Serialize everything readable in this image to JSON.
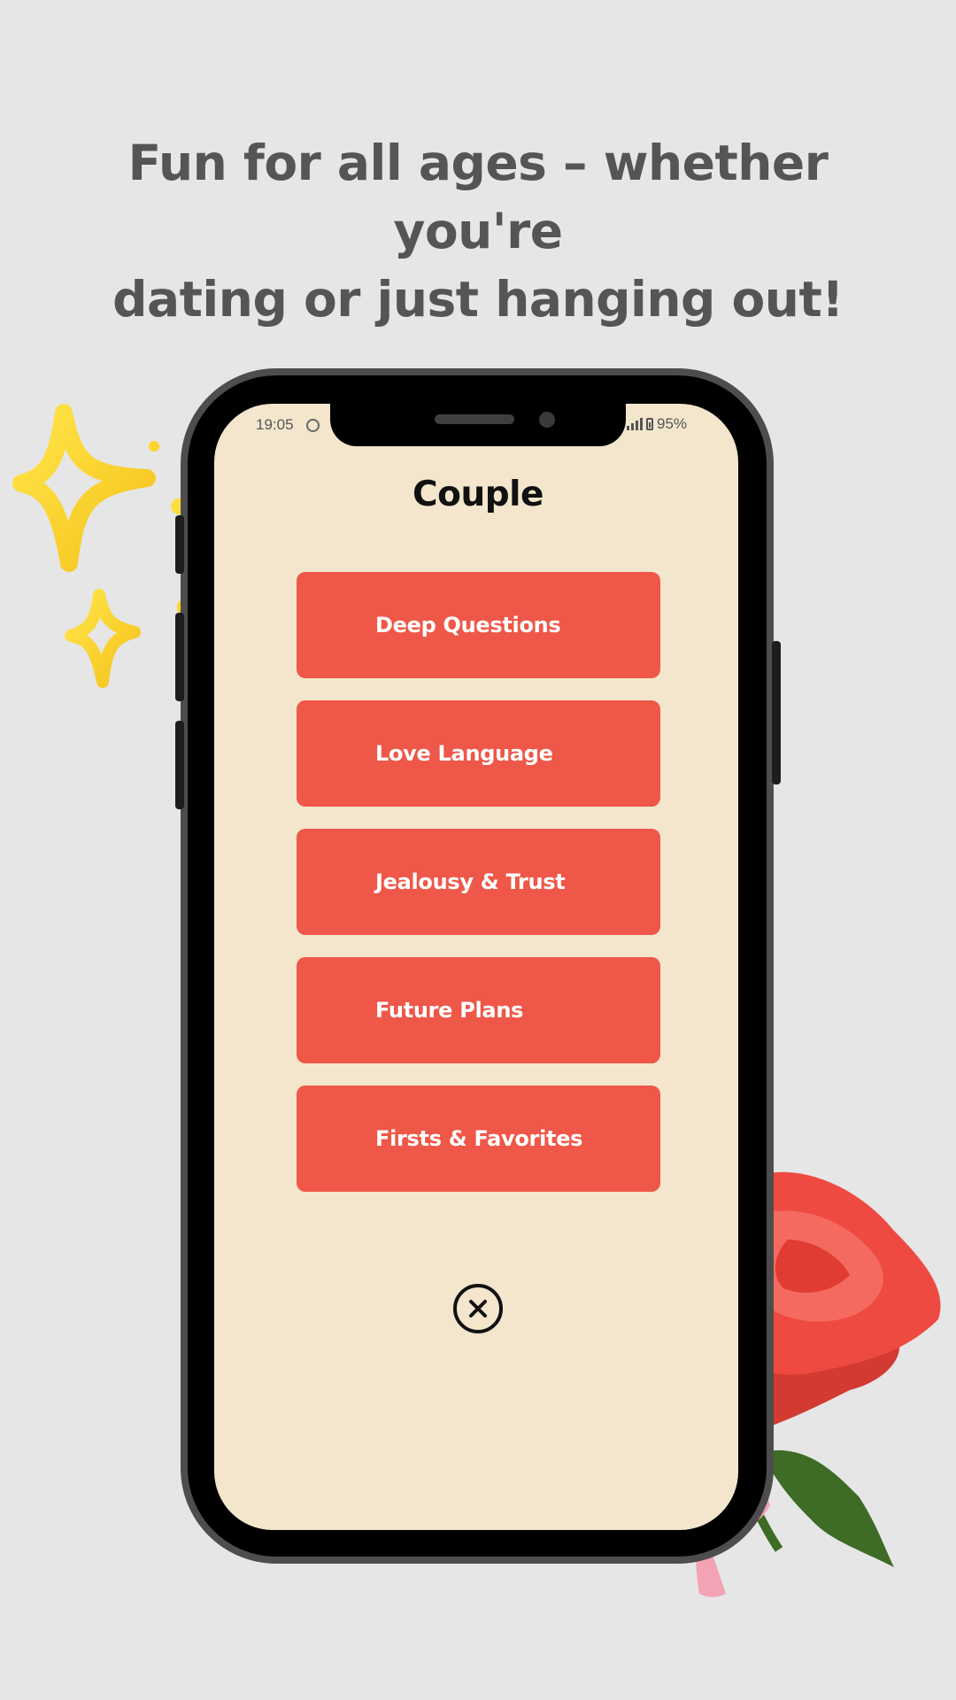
{
  "headline": {
    "line1": "Fun for all ages – whether you're",
    "line2": "dating or just hanging out!"
  },
  "status_bar": {
    "time": "19:05",
    "battery": "95%"
  },
  "screen": {
    "title": "Couple",
    "categories": [
      {
        "label": "Deep Questions"
      },
      {
        "label": "Love Language"
      },
      {
        "label": "Jealousy & Trust"
      },
      {
        "label": "Future Plans"
      },
      {
        "label": "Firsts & Favorites"
      }
    ],
    "close_icon": "close-circle-icon"
  },
  "colors": {
    "background": "#e6e6e7",
    "headline": "#555555",
    "screen": "#f3e6cd",
    "button": "#ef5748",
    "button_text": "#ffffff"
  }
}
